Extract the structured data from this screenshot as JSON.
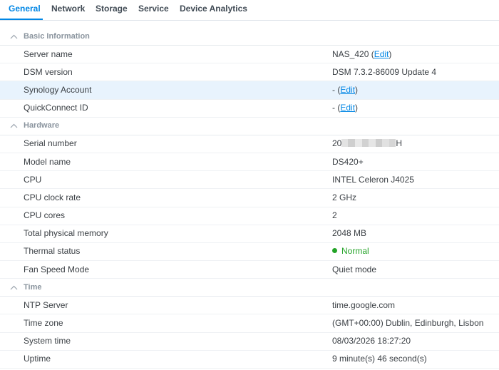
{
  "tabs": [
    {
      "label": "General",
      "active": true
    },
    {
      "label": "Network",
      "active": false
    },
    {
      "label": "Storage",
      "active": false
    },
    {
      "label": "Service",
      "active": false
    },
    {
      "label": "Device Analytics",
      "active": false
    }
  ],
  "colors": {
    "accent": "#0086e5",
    "status_ok": "#23a327",
    "highlight_row": "#e8f3fd"
  },
  "sections": {
    "basic": {
      "title": "Basic Information",
      "server_name": {
        "label": "Server name",
        "value": "NAS_420",
        "edit": "Edit"
      },
      "dsm_version": {
        "label": "DSM version",
        "value": "DSM 7.3.2-86009 Update 4"
      },
      "synology_account": {
        "label": "Synology Account",
        "value": "-",
        "edit": "Edit"
      },
      "quickconnect": {
        "label": "QuickConnect ID",
        "value": "-",
        "edit": "Edit"
      }
    },
    "hardware": {
      "title": "Hardware",
      "serial": {
        "label": "Serial number",
        "prefix": "20",
        "suffix": "H"
      },
      "model": {
        "label": "Model name",
        "value": "DS420+"
      },
      "cpu": {
        "label": "CPU",
        "value": "INTEL Celeron J4025"
      },
      "clock": {
        "label": "CPU clock rate",
        "value": "2 GHz"
      },
      "cores": {
        "label": "CPU cores",
        "value": "2"
      },
      "memory": {
        "label": "Total physical memory",
        "value": "2048 MB"
      },
      "thermal": {
        "label": "Thermal status",
        "value": "Normal"
      },
      "fan": {
        "label": "Fan Speed Mode",
        "value": "Quiet mode"
      }
    },
    "time": {
      "title": "Time",
      "ntp": {
        "label": "NTP Server",
        "value": "time.google.com"
      },
      "zone": {
        "label": "Time zone",
        "value": "(GMT+00:00) Dublin, Edinburgh, Lisbon"
      },
      "system_time": {
        "label": "System time",
        "value": "08/03/2026 18:27:20"
      },
      "uptime": {
        "label": "Uptime",
        "value": "9 minute(s) 46 second(s)"
      }
    }
  }
}
